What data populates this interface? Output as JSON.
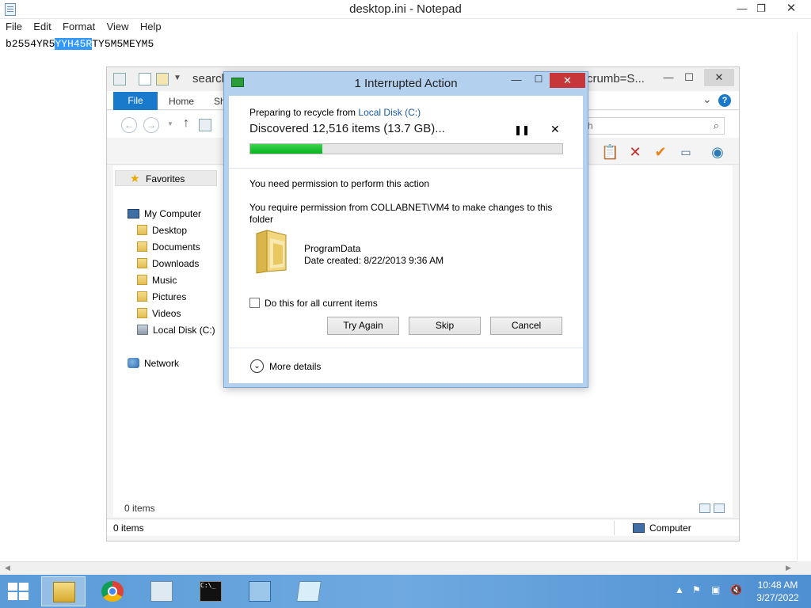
{
  "notepad": {
    "title": "desktop.ini - Notepad",
    "menu": [
      "File",
      "Edit",
      "Format",
      "View",
      "Help"
    ],
    "text_before": "b2554YR5",
    "text_selected": "YYH45R",
    "text_after": "TY5M5MEYM5"
  },
  "explorer": {
    "title_left": "search",
    "title_right": "crumb=S...",
    "tabs": {
      "file": "File",
      "home": "Home",
      "share": "Sh"
    },
    "search_placeholder": "ch",
    "favorites": "Favorites",
    "tree": {
      "computer": "My Computer",
      "desktop": "Desktop",
      "documents": "Documents",
      "downloads": "Downloads",
      "music": "Music",
      "pictures": "Pictures",
      "videos": "Videos",
      "local_disk": "Local Disk (C:)",
      "network": "Network"
    },
    "items_inner": "0 items",
    "status_items": "0 items",
    "status_computer": "Computer"
  },
  "dialog": {
    "title": "1 Interrupted Action",
    "preparing_prefix": "Preparing to recycle from ",
    "preparing_link": "Local Disk (C:)",
    "discovered": "Discovered 12,516 items (13.7 GB)...",
    "progress_fraction": 0.23,
    "need_permission": "You need permission to perform this action",
    "require_permission": "You require permission from COLLABNET\\VM4 to make changes to this folder",
    "folder_name": "ProgramData",
    "date_created": "Date created: 8/22/2013 9:36 AM",
    "checkbox_label": "Do this for all current items",
    "buttons": {
      "try_again": "Try Again",
      "skip": "Skip",
      "cancel": "Cancel"
    },
    "more_details": "More details",
    "colors": {
      "progress": "#07b21f",
      "close": "#c7373a",
      "link": "#1a5aa8"
    }
  },
  "taskbar": {
    "time": "10:48 AM",
    "date": "3/27/2022",
    "apps": [
      "file-explorer-icon",
      "chrome-icon",
      "task-manager-icon",
      "cmd-icon",
      "window-icon",
      "notepad-icon"
    ]
  }
}
